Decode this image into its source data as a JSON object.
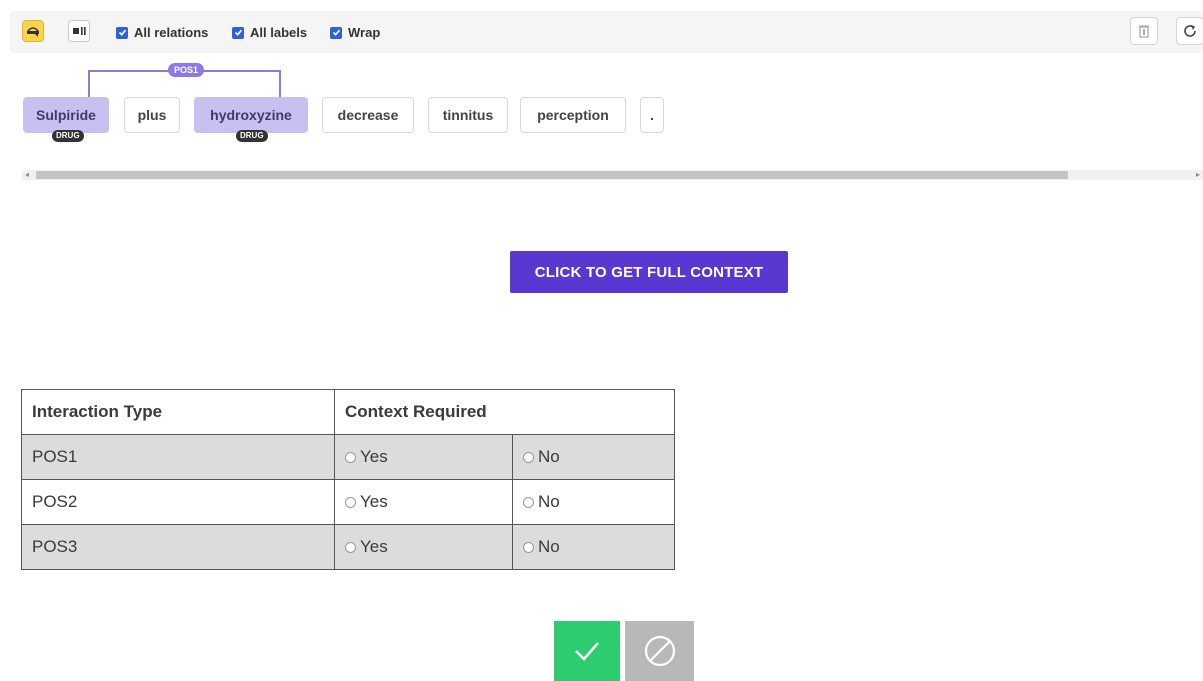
{
  "toolbar": {
    "all_relations": "All relations",
    "all_labels": "All labels",
    "wrap": "Wrap"
  },
  "tokens": [
    "Sulpiride",
    "plus",
    "hydroxyzine",
    "decrease",
    "tinnitus",
    "perception",
    "."
  ],
  "entity_label": "DRUG",
  "relation_label": "POS1",
  "context_button": "CLICK TO GET FULL CONTEXT",
  "table": {
    "headers": [
      "Interaction Type",
      "Context Required"
    ],
    "rows": [
      {
        "type": "POS1",
        "yes": "Yes",
        "no": "No"
      },
      {
        "type": "POS2",
        "yes": "Yes",
        "no": "No"
      },
      {
        "type": "POS3",
        "yes": "Yes",
        "no": "No"
      }
    ]
  },
  "colors": {
    "accent": "#5b37d1",
    "entity": "#c9c0f2",
    "relation": "#8c79e6",
    "accept": "#2ecc71",
    "reject": "#b8b8b8"
  }
}
